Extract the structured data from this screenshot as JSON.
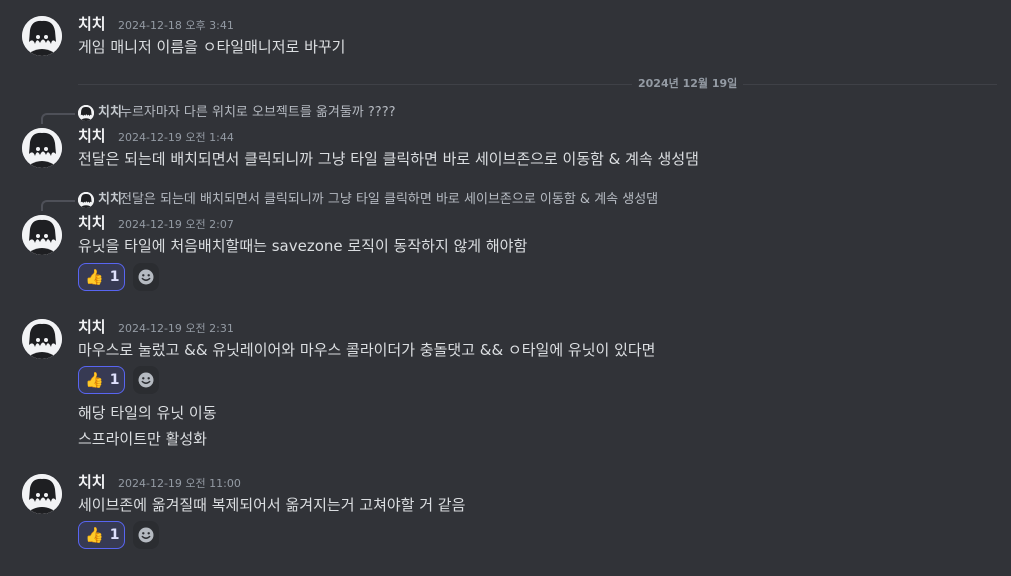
{
  "date_divider": "2024년 12월 19일",
  "messages": [
    {
      "author": "치치",
      "timestamp": "2024-12-18 오후 3:41",
      "lines": [
        "게임 매니저 이름을 ㅇ타일매니저로 바꾸기"
      ]
    },
    {
      "reply": {
        "author": "치치",
        "text": "누르자마자 다른 위치로 오브젝트를 옮겨둘까 ????"
      },
      "author": "치치",
      "timestamp": "2024-12-19 오전 1:44",
      "lines": [
        "전달은 되는데 배치되면서 클릭되니까 그냥 타일 클릭하면 바로 세이브존으로 이동함 & 계속 생성댐"
      ]
    },
    {
      "reply": {
        "author": "치치",
        "text": "전달은 되는데 배치되면서 클릭되니까 그냥 타일 클릭하면 바로 세이브존으로 이동함 & 계속 생성댐"
      },
      "author": "치치",
      "timestamp": "2024-12-19 오전 2:07",
      "lines": [
        "유닛을 타일에 처음배치할때는 savezone 로직이 동작하지 않게 해야함"
      ],
      "reaction": {
        "emoji": "👍",
        "count": "1"
      }
    },
    {
      "author": "치치",
      "timestamp": "2024-12-19 오전 2:31",
      "lines": [
        "마우스로 눌렀고 && 유닛레이어와 마우스 콜라이더가 충돌댓고 && ㅇ타일에 유닛이 있다면"
      ],
      "reaction": {
        "emoji": "👍",
        "count": "1"
      },
      "followups": [
        "해당 타일의 유닛 이동",
        "스프라이트만 활성화"
      ]
    },
    {
      "author": "치치",
      "timestamp": "2024-12-19 오전 11:00",
      "lines": [
        "세이브존에 옮겨질때 복제되어서 옮겨지는거 고쳐야할 거 같음"
      ],
      "reaction": {
        "emoji": "👍",
        "count": "1"
      }
    }
  ],
  "icons": {
    "avatar": "avatar-icon",
    "add_reaction": "add-reaction-icon"
  },
  "colors": {
    "background": "#313338",
    "reaction_border": "#5865f2",
    "reaction_bg": "#373a53"
  }
}
